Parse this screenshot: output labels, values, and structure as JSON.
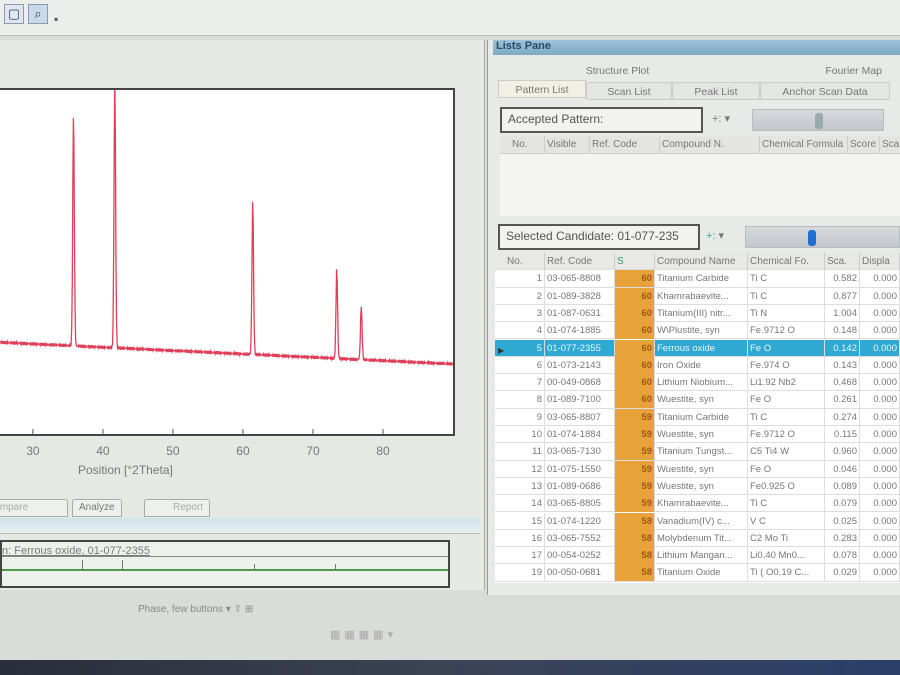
{
  "toolbar": {
    "icons": [
      "window-icon",
      "zoom-icon"
    ]
  },
  "lists_pane": {
    "title": "Lists Pane",
    "tabs_row1": [
      "Structure Plot",
      "Fourier Map"
    ],
    "tabs_row2": [
      "Pattern List",
      "Scan List",
      "Peak List",
      "Anchor Scan Data"
    ],
    "active_tab": "Pattern List",
    "accepted_label": "Accepted Pattern:",
    "accepted_columns": [
      "No.",
      "Visible",
      "Ref. Code",
      "Compound N.",
      "Chemical Formula",
      "Score",
      "Sca"
    ],
    "candidate_label": "Selected Candidate: 01-077-235",
    "sort_icon": "+:",
    "candidate_columns": [
      "No.",
      "Ref. Code",
      "S",
      "Compound Name",
      "Chemical Fo.",
      "Sca.",
      "Displa"
    ],
    "rows": [
      [
        "1",
        "03-065-8808",
        "60",
        "Titanium Carbide",
        "Ti C",
        "0.582",
        "0.000"
      ],
      [
        "2",
        "01-089-3828",
        "60",
        "Khamrabaevite...",
        "Ti C",
        "0.877",
        "0.000"
      ],
      [
        "3",
        "01-087-0631",
        "60",
        "Titanium(III) nitr...",
        "Ti N",
        "1.004",
        "0.000"
      ],
      [
        "4",
        "01-074-1885",
        "60",
        "W\\Plustite, syn",
        "Fe.9712 O",
        "0.148",
        "0.000"
      ],
      [
        "5",
        "01-077-2355",
        "60",
        "Ferrous oxide",
        "Fe O",
        "0.142",
        "0.000"
      ],
      [
        "6",
        "01-073-2143",
        "60",
        "Iron Oxide",
        "Fe.974 O",
        "0.143",
        "0.000"
      ],
      [
        "7",
        "00-049-0868",
        "60",
        "Lithium Niobium...",
        "Li1.92 Nb2",
        "0.468",
        "0.000"
      ],
      [
        "8",
        "01-089-7100",
        "60",
        "Wuestite, syn",
        "Fe O",
        "0.261",
        "0.000"
      ],
      [
        "9",
        "03-065-8807",
        "59",
        "Titanium Carbide",
        "Ti C",
        "0.274",
        "0.000"
      ],
      [
        "10",
        "01-074-1884",
        "59",
        "Wuestite, syn",
        "Fe.9712 O",
        "0.115",
        "0.000"
      ],
      [
        "11",
        "03-065-7130",
        "59",
        "Titanium Tungst...",
        "C5 Ti4 W",
        "0.960",
        "0.000"
      ],
      [
        "12",
        "01-075-1550",
        "59",
        "Wuestite, syn",
        "Fe O",
        "0.046",
        "0.000"
      ],
      [
        "13",
        "01-089-0686",
        "59",
        "Wuestite, syn",
        "Fe0.925 O",
        "0.089",
        "0.000"
      ],
      [
        "14",
        "03-065-8805",
        "59",
        "Khamrabaevite...",
        "Ti C",
        "0.079",
        "0.000"
      ],
      [
        "15",
        "01-074-1220",
        "58",
        "Vanadium(IV) c...",
        "V C",
        "0.025",
        "0.000"
      ],
      [
        "16",
        "03-065-7552",
        "58",
        "Molybdenum Tit...",
        "C2 Mo Ti",
        "0.283",
        "0.000"
      ],
      [
        "17",
        "00-054-0252",
        "58",
        "Lithium Mangan...",
        "Li0.40 Mn0...",
        "0.078",
        "0.000"
      ],
      [
        "19",
        "00-050-0681",
        "58",
        "Titanium Oxide",
        "Ti ( O0.19 C...",
        "0.029",
        "0.000"
      ]
    ],
    "selected_row": 4
  },
  "plot_tabs": [
    "Compare",
    "Analyze",
    "Report"
  ],
  "phase_label": "n: Ferrous oxide, 01-077-2355",
  "phase_buttons_label": "Phase, few buttons",
  "colors": {
    "trace": "#e0405a",
    "score": "#e8a23a",
    "selected": "#2fa9d2",
    "header": "#8fb6cf"
  },
  "chart_data": {
    "type": "line",
    "xlabel": "Position [°2Theta]",
    "ylabel": "",
    "xlim": [
      25.3,
      90
    ],
    "ylim": [
      0,
      100
    ],
    "xticks": [
      30,
      40,
      50,
      60,
      70,
      80
    ],
    "peaks": [
      {
        "x": 35.8,
        "y": 86
      },
      {
        "x": 41.7,
        "y": 100
      },
      {
        "x": 61.4,
        "y": 57
      },
      {
        "x": 73.4,
        "y": 33
      },
      {
        "x": 76.9,
        "y": 20
      }
    ],
    "background": {
      "start": 8,
      "end": 0
    }
  }
}
